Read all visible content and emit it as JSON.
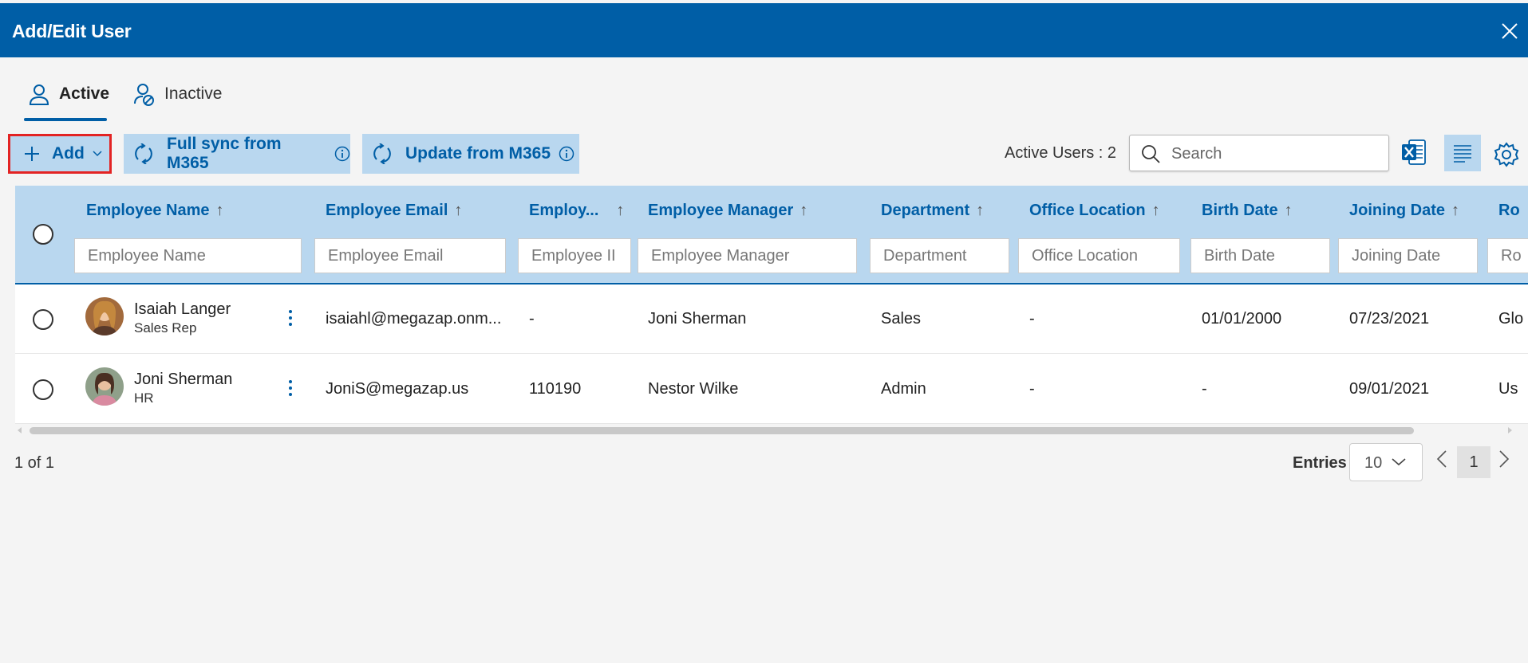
{
  "dialog": {
    "title": "Add/Edit User"
  },
  "tabs": [
    {
      "label": "Active",
      "icon": "user-icon",
      "selected": true
    },
    {
      "label": "Inactive",
      "icon": "user-blocked-icon",
      "selected": false
    }
  ],
  "toolbar": {
    "add_label": "Add",
    "full_sync_label": "Full sync from M365",
    "update_label": "Update from M365",
    "active_users_label": "Active Users : 2",
    "search_placeholder": "Search"
  },
  "table": {
    "columns": [
      {
        "label": "Employee Name",
        "filter_placeholder": "Employee Name"
      },
      {
        "label": "Employee Email",
        "filter_placeholder": "Employee Email"
      },
      {
        "label": "Employ...",
        "filter_placeholder": "Employee II"
      },
      {
        "label": "Employee Manager",
        "filter_placeholder": "Employee Manager"
      },
      {
        "label": "Department",
        "filter_placeholder": "Department"
      },
      {
        "label": "Office Location",
        "filter_placeholder": "Office Location"
      },
      {
        "label": "Birth Date",
        "filter_placeholder": "Birth Date"
      },
      {
        "label": "Joining Date",
        "filter_placeholder": "Joining Date"
      },
      {
        "label": "Ro",
        "filter_placeholder": "Ro"
      }
    ],
    "sort_arrow": "↑",
    "rows": [
      {
        "name": "Isaiah Langer",
        "role": "Sales Rep",
        "email": "isaiahl@megazap.onm...",
        "employee_id": "-",
        "manager": "Joni Sherman",
        "department": "Sales",
        "office": "-",
        "birth_date": "01/01/2000",
        "joining_date": "07/23/2021",
        "extra": "Glo"
      },
      {
        "name": "Joni Sherman",
        "role": "HR",
        "email": "JoniS@megazap.us",
        "employee_id": "110190",
        "manager": "Nestor Wilke",
        "department": "Admin",
        "office": "-",
        "birth_date": "-",
        "joining_date": "09/01/2021",
        "extra": "Us"
      }
    ]
  },
  "pagination": {
    "info": "1 of 1",
    "entries_label": "Entries",
    "entries_value": "10",
    "current_page": "1"
  },
  "colors": {
    "brand": "#005ea6",
    "header_bg": "#b9d7ef",
    "highlight_border": "#e32323"
  }
}
